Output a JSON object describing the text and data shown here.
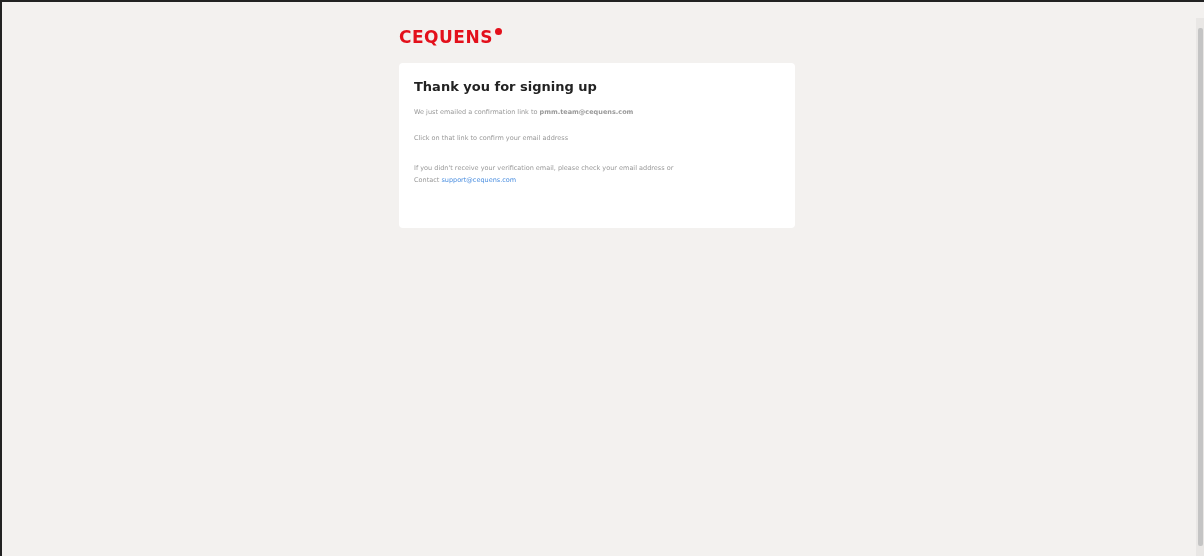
{
  "logo": {
    "text": "CEQUENS"
  },
  "card": {
    "title": "Thank you for signing up",
    "line_1": "We just emailed a confirmation link to **pmm.team@cequens.com**",
    "line_2": "Click on that link to confirm your email address",
    "line_3": "If you didn't receive your verification email, please check your email address or",
    "contact_label": "Contact",
    "contact_link": "support@cequens.com"
  }
}
